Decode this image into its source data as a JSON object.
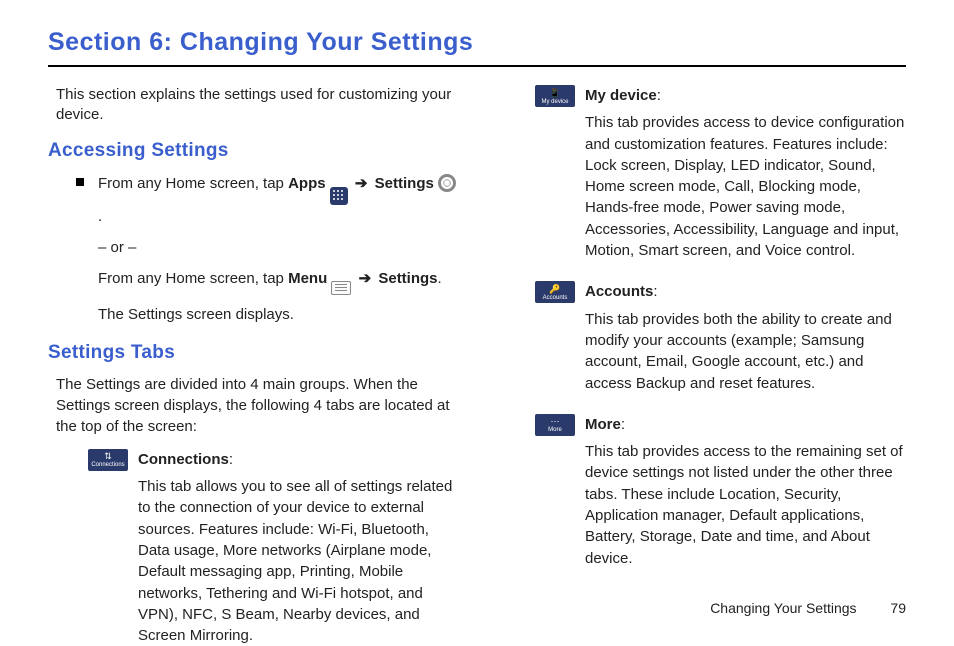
{
  "section_title": "Section 6: Changing Your Settings",
  "intro": "This section explains the settings used for customizing your device.",
  "accessing": {
    "heading": "Accessing Settings",
    "line1_pre": "From any Home screen, tap ",
    "apps_label": "Apps",
    "arrow": "➔",
    "settings_label": "Settings",
    "period": ".",
    "or": "– or –",
    "line2_pre": "From any Home screen, tap ",
    "menu_label": "Menu",
    "result": "The Settings screen displays."
  },
  "tabs": {
    "heading": "Settings Tabs",
    "intro": "The Settings are divided into 4 main groups. When the Settings screen displays, the following 4 tabs are located at the top of the screen:",
    "items": [
      {
        "icon_label": "Connections",
        "glyph": "⇅",
        "title": "Connections",
        "desc": "This tab allows you to see all of settings related to the connection of your device to external sources. Features include: Wi-Fi, Bluetooth, Data usage, More networks (Airplane mode, Default messaging app, Printing, Mobile networks, Tethering and Wi-Fi hotspot, and VPN), NFC, S Beam, Nearby devices, and Screen Mirroring."
      },
      {
        "icon_label": "My device",
        "glyph": "📱",
        "title": "My device",
        "desc": "This tab provides access to device configuration and customization features. Features include: Lock screen, Display, LED indicator, Sound, Home screen mode, Call, Blocking mode, Hands-free mode, Power saving mode, Accessories, Accessibility, Language and input, Motion, Smart screen, and Voice control."
      },
      {
        "icon_label": "Accounts",
        "glyph": "🔑",
        "title": "Accounts",
        "desc": "This tab provides both the ability to create and modify your accounts (example; Samsung account, Email, Google account, etc.) and access Backup and reset features."
      },
      {
        "icon_label": "More",
        "glyph": "⋯",
        "title": "More",
        "desc": "This tab provides access to the remaining set of device settings not listed under the other three tabs. These include Location, Security, Application manager, Default applications, Battery, Storage, Date and time, and About device."
      }
    ]
  },
  "footer": {
    "text": "Changing Your Settings",
    "page": "79"
  }
}
